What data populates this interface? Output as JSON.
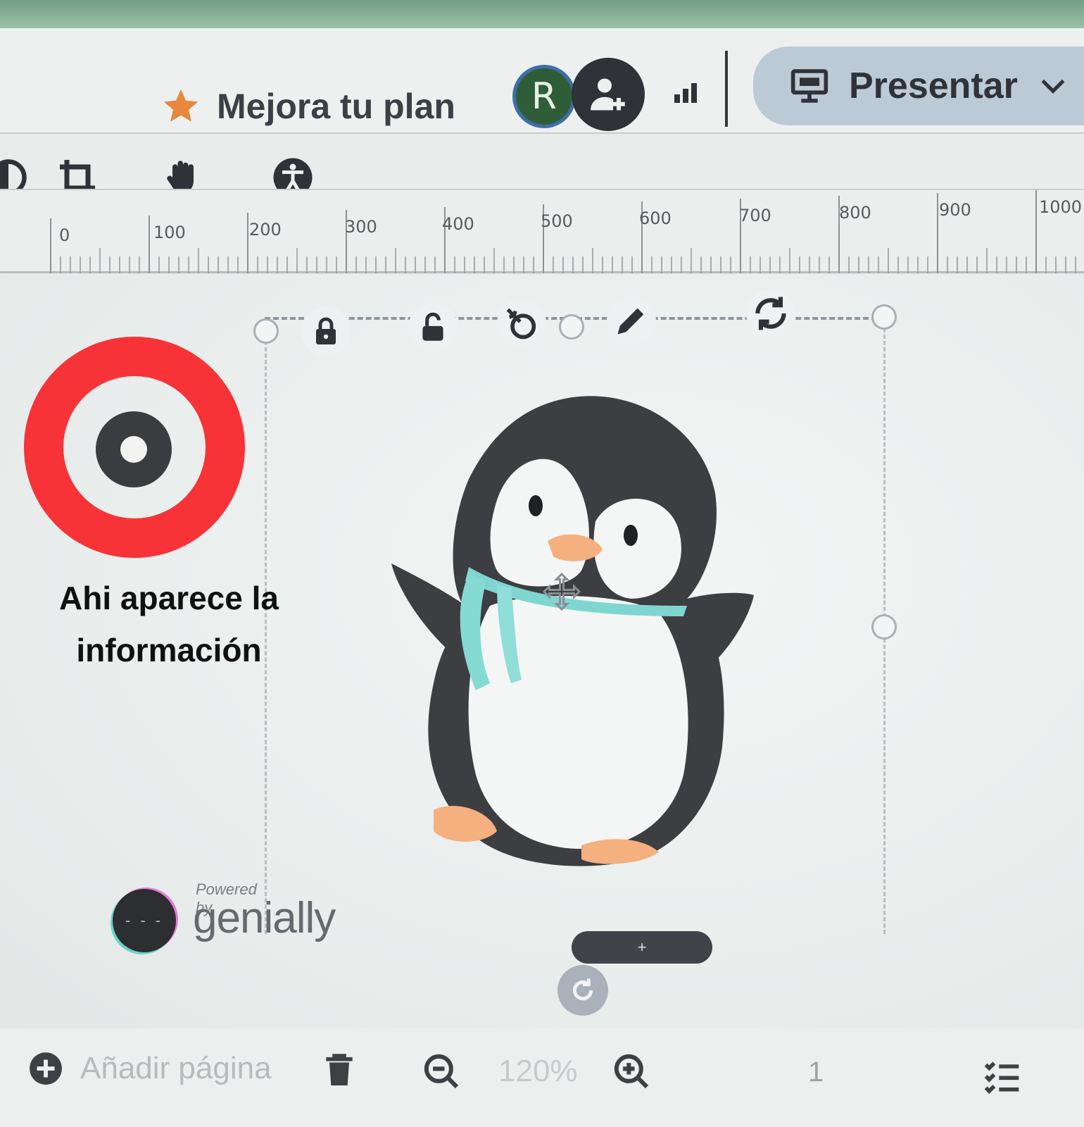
{
  "header": {
    "upgrade_label": "Mejora tu plan",
    "avatar_initial": "R",
    "present_label": "Presentar"
  },
  "ruler": {
    "marks": [
      "0",
      "100",
      "200",
      "300",
      "400",
      "500",
      "600",
      "700",
      "800",
      "900",
      "1000"
    ]
  },
  "annotation": {
    "text_line1": "Ahi aparece la",
    "text_line2": "información",
    "ring_color": "#f73338"
  },
  "branding": {
    "powered_by": "Powered by",
    "brand": "genially"
  },
  "selection": {
    "add_label": "+"
  },
  "footer": {
    "add_page_label": "Añadir página",
    "zoom": "120%",
    "page_number": "1"
  },
  "icons": {
    "toolbar": [
      "adjust-icon",
      "crop-icon",
      "hand-icon",
      "accessibility-icon"
    ],
    "element_tools": [
      "lock-icon",
      "unlock-icon",
      "interactivity-icon",
      "edit-pencil-icon",
      "replace-icon"
    ]
  },
  "colors": {
    "accent_star": "#e8883f",
    "avatar_bg": "#2f5d38",
    "present_bg": "#bccad6"
  }
}
